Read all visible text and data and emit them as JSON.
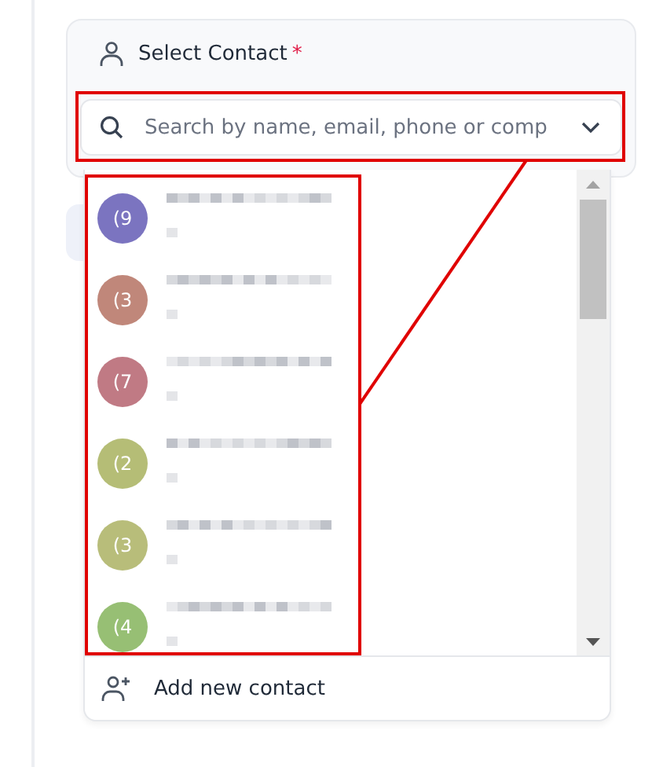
{
  "field": {
    "label": "Select Contact",
    "required_mark": "*",
    "placeholder": "Search by name, email, phone or comp"
  },
  "contacts": [
    {
      "initials": "(9",
      "color": "#7b74c0"
    },
    {
      "initials": "(3",
      "color": "#c0877a"
    },
    {
      "initials": "(7",
      "color": "#c07a84"
    },
    {
      "initials": "(2",
      "color": "#b5bd76"
    },
    {
      "initials": "(3",
      "color": "#b8bd7a"
    },
    {
      "initials": "(4",
      "color": "#97bf74"
    }
  ],
  "footer": {
    "label": "Add new contact"
  }
}
